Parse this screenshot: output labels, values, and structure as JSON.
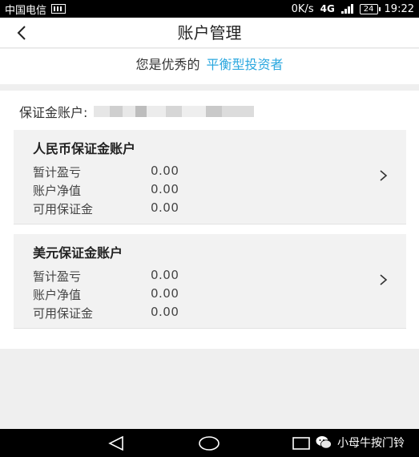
{
  "status_bar": {
    "carrier": "中国电信",
    "speed": "0K/s",
    "network": "4G",
    "network_small": "4G 2G",
    "battery": "24",
    "time": "19:22"
  },
  "nav": {
    "title": "账户管理"
  },
  "investor": {
    "prefix": "您是优秀的",
    "type": "平衡型投资者",
    "type_color": "#2aa7df"
  },
  "margin_account": {
    "label": "保证金账户:"
  },
  "accounts": [
    {
      "title": "人民币保证金账户",
      "rows": [
        {
          "label": "暂计盈亏",
          "value": "0.00"
        },
        {
          "label": "账户净值",
          "value": "0.00"
        },
        {
          "label": "可用保证金",
          "value": "0.00"
        }
      ]
    },
    {
      "title": "美元保证金账户",
      "rows": [
        {
          "label": "暂计盈亏",
          "value": "0.00"
        },
        {
          "label": "账户净值",
          "value": "0.00"
        },
        {
          "label": "可用保证金",
          "value": "0.00"
        }
      ]
    }
  ],
  "watermark": {
    "text": "小母牛按门铃"
  }
}
